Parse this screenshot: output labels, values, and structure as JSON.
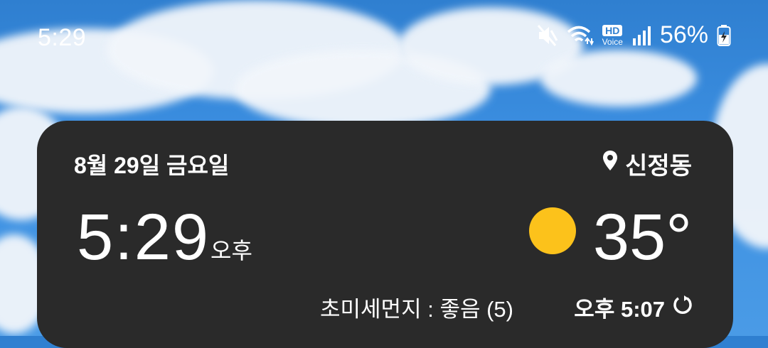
{
  "status_bar": {
    "time": "5:29",
    "hd_label": "HD",
    "voice_label": "Voice",
    "battery_percent": "56%",
    "icons": [
      "mute-icon",
      "wifi-icon",
      "hd-voice-icon",
      "signal-icon",
      "battery-charging-icon"
    ]
  },
  "widget": {
    "date": "8월 29일 금요일",
    "location": "신정동",
    "time": "5:29",
    "ampm": "오후",
    "temperature": "35°",
    "weather_icon": "sunny-icon",
    "fine_dust": "초미세먼지 : 좋음 (5)",
    "updated_time": "오후 5:07",
    "colors": {
      "background": "#2a2a2a",
      "sun": "#fcc21b"
    }
  }
}
